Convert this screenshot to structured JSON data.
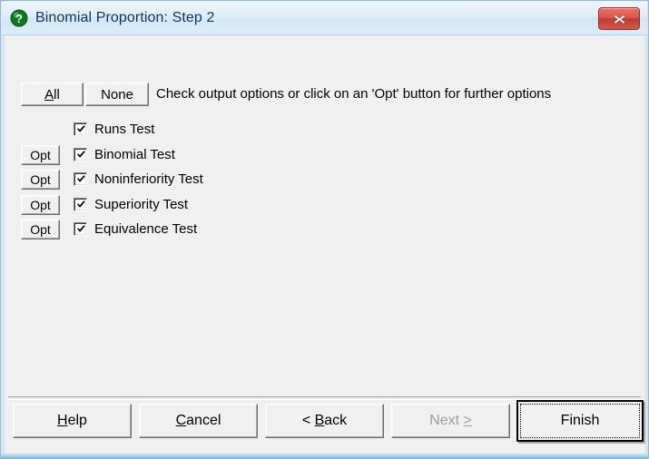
{
  "window": {
    "title": "Binomial Proportion: Step 2",
    "icon": "question-mark-icon",
    "close_label": "x",
    "accent_title_color": "#12355e",
    "close_button_color": "#c0392b",
    "titlebar_color": "#dcecf8",
    "client_background": "#f0f0f0"
  },
  "toolbar": {
    "all_label": "All",
    "all_accelerator": "A",
    "none_label": "None",
    "none_accelerator": "N",
    "instruction": "Check output options or click on an 'Opt' button for further options"
  },
  "options": {
    "opt_button_label": "Opt",
    "rows": [
      {
        "label": "Runs Test",
        "checked": true,
        "has_opt": false
      },
      {
        "label": "Binomial Test",
        "checked": true,
        "has_opt": true
      },
      {
        "label": "Noninferiority Test",
        "checked": true,
        "has_opt": true
      },
      {
        "label": "Superiority Test",
        "checked": true,
        "has_opt": true
      },
      {
        "label": "Equivalence Test",
        "checked": true,
        "has_opt": true
      }
    ]
  },
  "footer": {
    "buttons": [
      {
        "label": "Help",
        "accelerator": "H",
        "enabled": true,
        "default": false
      },
      {
        "label": "Cancel",
        "accelerator": "C",
        "enabled": true,
        "default": false
      },
      {
        "label": "< Back",
        "accelerator": "B",
        "enabled": true,
        "default": false
      },
      {
        "label": "Next >",
        "accelerator": ">",
        "enabled": false,
        "default": false
      },
      {
        "label": "Finish",
        "accelerator": "F",
        "enabled": true,
        "default": true
      }
    ]
  }
}
